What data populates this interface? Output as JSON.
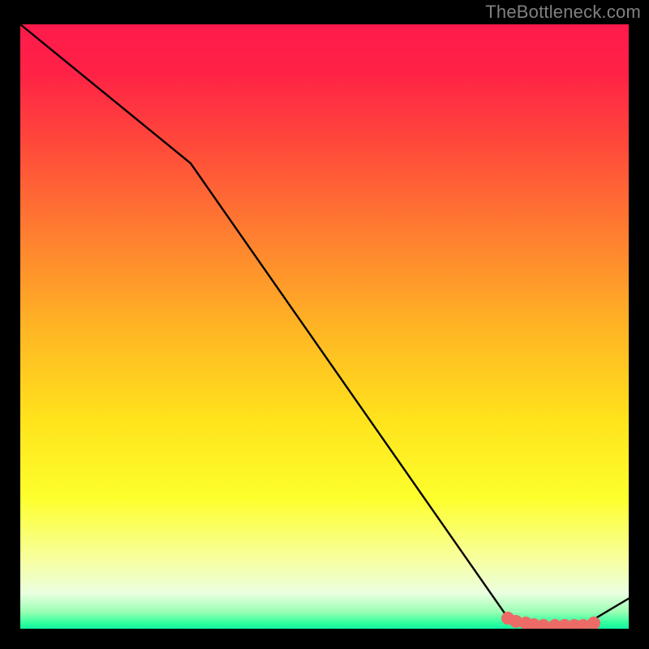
{
  "attribution": "TheBottleneck.com",
  "gradient_stops": [
    {
      "offset": 0.0,
      "color": "#ff1a4b"
    },
    {
      "offset": 0.08,
      "color": "#ff2246"
    },
    {
      "offset": 0.2,
      "color": "#ff4a3a"
    },
    {
      "offset": 0.35,
      "color": "#ff8030"
    },
    {
      "offset": 0.5,
      "color": "#ffb524"
    },
    {
      "offset": 0.65,
      "color": "#ffe31c"
    },
    {
      "offset": 0.78,
      "color": "#fdff2d"
    },
    {
      "offset": 0.88,
      "color": "#f7ffa0"
    },
    {
      "offset": 0.935,
      "color": "#eaffe0"
    },
    {
      "offset": 0.965,
      "color": "#9cffb5"
    },
    {
      "offset": 0.985,
      "color": "#2bff9d"
    },
    {
      "offset": 1.0,
      "color": "#00e7a6"
    }
  ],
  "chart_data": {
    "type": "line",
    "title": "",
    "xlabel": "",
    "ylabel": "",
    "xlim": [
      0,
      100
    ],
    "ylim": [
      0,
      100
    ],
    "series": [
      {
        "name": "curve",
        "x": [
          0,
          28,
          80,
          86.5,
          92.5,
          100
        ],
        "values": [
          100,
          77,
          2,
          0.5,
          0.5,
          5
        ]
      }
    ],
    "dots": [
      {
        "x": 80.2,
        "y": 1.8
      },
      {
        "x": 81.5,
        "y": 1.2
      },
      {
        "x": 83.0,
        "y": 0.9
      },
      {
        "x": 84.4,
        "y": 0.7
      },
      {
        "x": 86.0,
        "y": 0.5
      },
      {
        "x": 87.8,
        "y": 0.5
      },
      {
        "x": 89.4,
        "y": 0.5
      },
      {
        "x": 91.0,
        "y": 0.5
      },
      {
        "x": 92.5,
        "y": 0.5
      },
      {
        "x": 94.2,
        "y": 0.9
      }
    ]
  }
}
